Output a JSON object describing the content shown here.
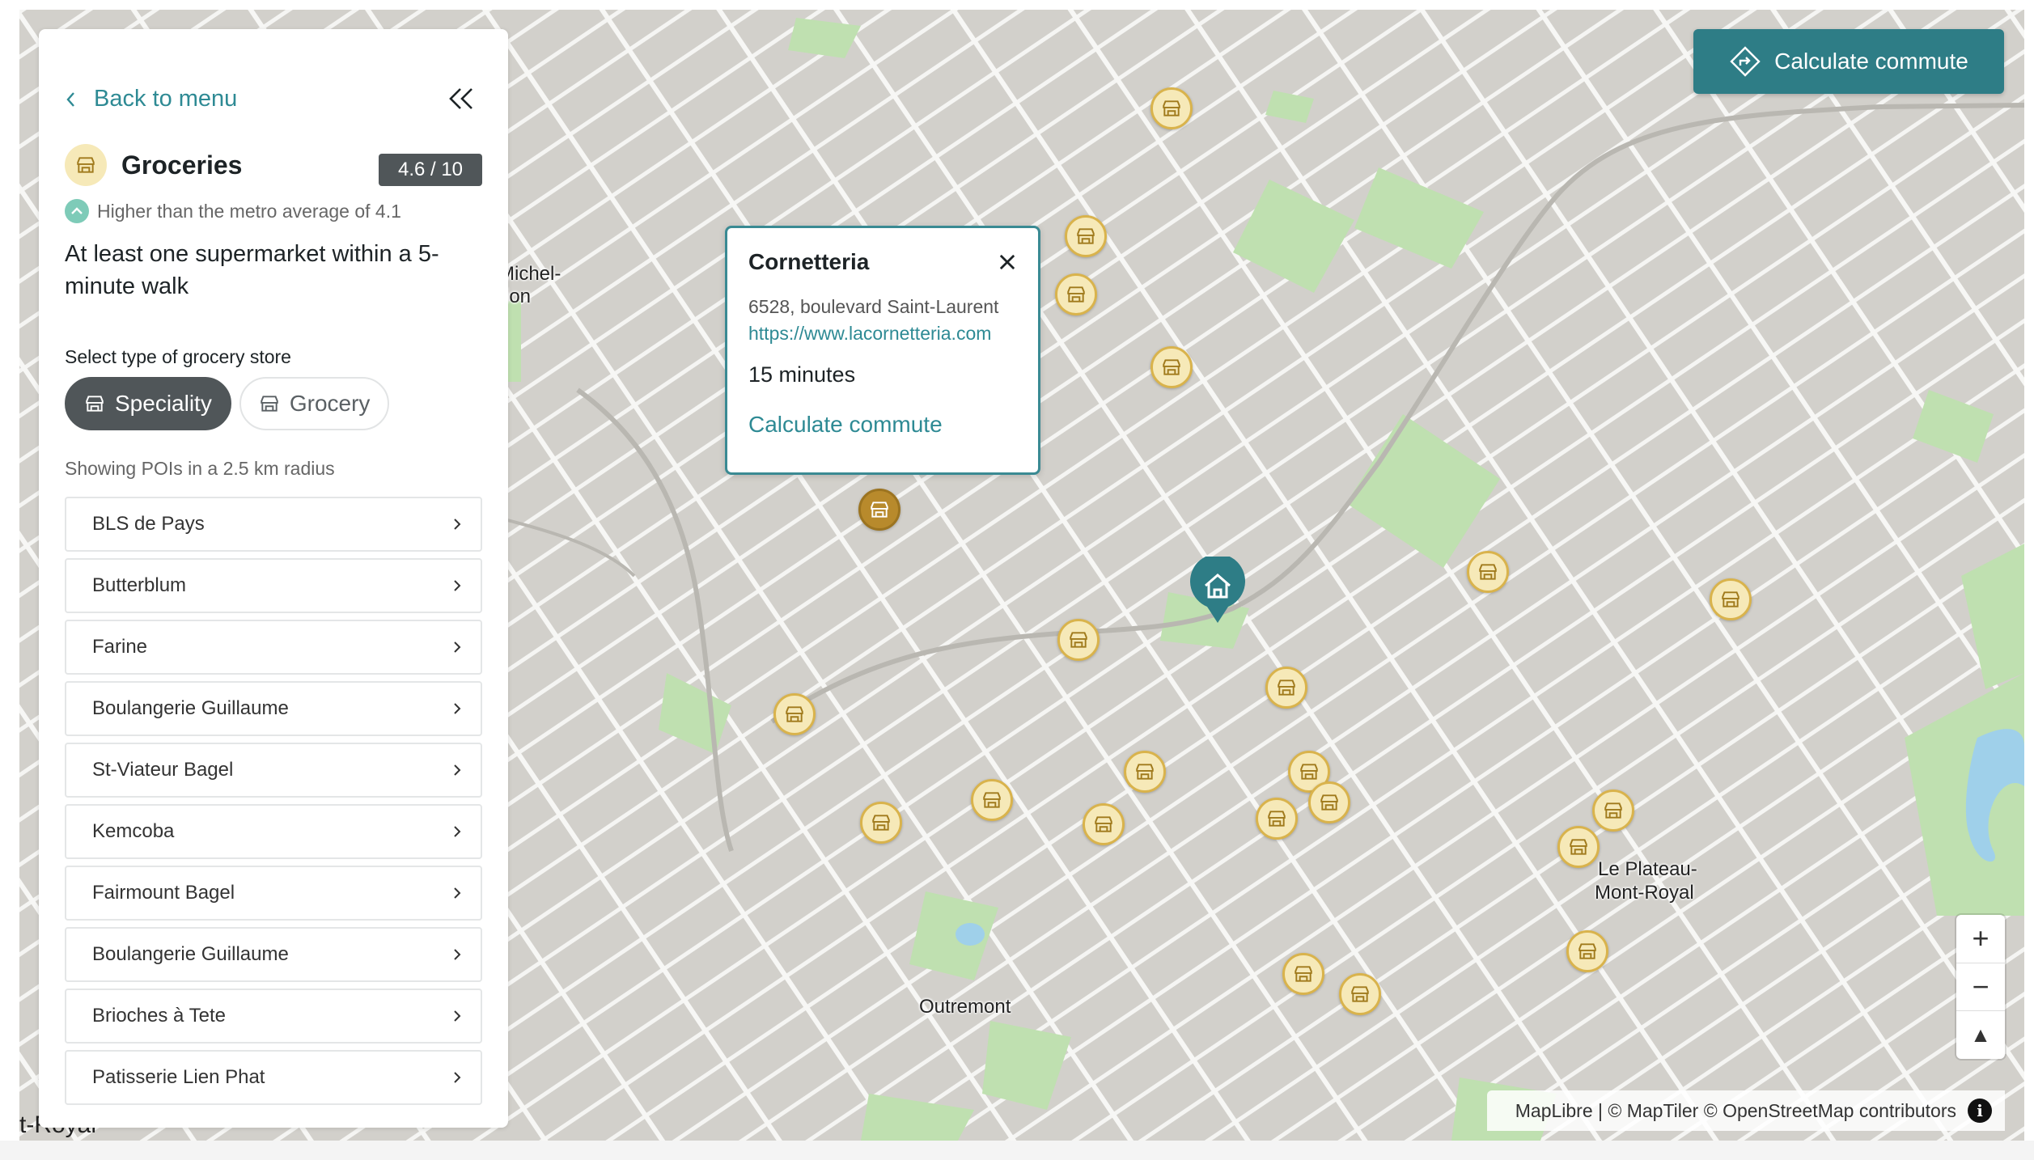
{
  "sidebar": {
    "back_label": "Back to menu",
    "category_title": "Groceries",
    "score": "4.6 / 10",
    "average_text": "Higher than the metro average of 4.1",
    "description": "At least one supermarket within a 5-minute walk",
    "select_label": "Select type of grocery store",
    "chips": [
      {
        "label": "Speciality",
        "active": true
      },
      {
        "label": "Grocery",
        "active": false
      }
    ],
    "radius_label": "Showing POIs in a 2.5 km radius",
    "items": [
      {
        "label": "BLS de Pays"
      },
      {
        "label": "Butterblum"
      },
      {
        "label": "Farine"
      },
      {
        "label": "Boulangerie Guillaume"
      },
      {
        "label": "St-Viateur Bagel"
      },
      {
        "label": "Kemcoba"
      },
      {
        "label": "Fairmount Bagel"
      },
      {
        "label": "Boulangerie Guillaume"
      },
      {
        "label": "Brioches à Tete"
      },
      {
        "label": "Patisserie Lien Phat"
      }
    ]
  },
  "popup": {
    "title": "Cornetteria",
    "address": "6528, boulevard Saint-Laurent",
    "url": "https://www.lacornetteria.com",
    "duration": "15 minutes",
    "commute_link": "Calculate commute"
  },
  "map": {
    "commute_button": "Calculate commute",
    "zoom_in": "+",
    "zoom_out": "−",
    "compass": "▲",
    "attribution": "MapLibre | © MapTiler © OpenStreetMap contributors",
    "info": "i",
    "labels": {
      "michel": "Michel-",
      "ion": "ion",
      "outremont": "Outremont",
      "plateau_line1": "Le Plateau-",
      "plateau_line2": "Mont-Royal",
      "royal": "t-Royal"
    }
  },
  "colors": {
    "accent": "#2e7d86",
    "poi_fill": "#f6e9b8",
    "poi_border": "#d9b34c",
    "park": "#bfe0b0",
    "badge": "#505659"
  }
}
